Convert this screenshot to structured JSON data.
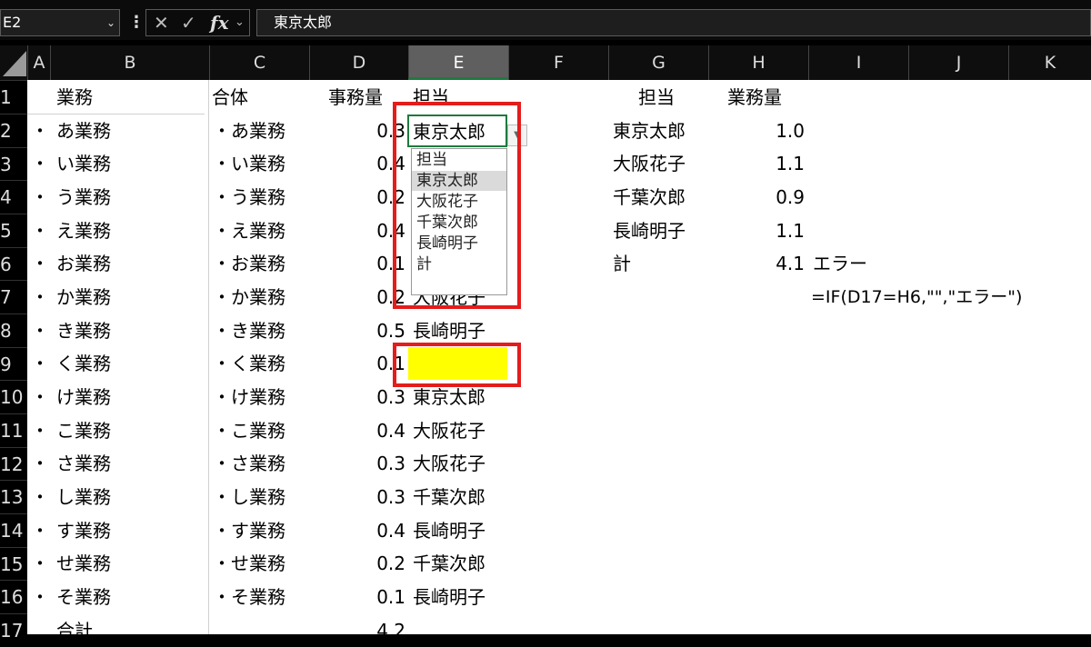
{
  "formula_bar": {
    "name_box": "E2",
    "name_box_dropdown": "⌄",
    "options_icon": "⋮",
    "cancel_icon": "✕",
    "enter_icon": "✓",
    "fx_label": "fx",
    "fx_dropdown": "⌄",
    "formula": "東京太郎"
  },
  "columns": [
    "A",
    "B",
    "C",
    "D",
    "E",
    "F",
    "G",
    "H",
    "I",
    "J",
    "K"
  ],
  "selected_column": "E",
  "rows": [
    "1",
    "2",
    "3",
    "4",
    "5",
    "6",
    "7",
    "8",
    "9",
    "10",
    "11",
    "12",
    "13",
    "14",
    "15",
    "16",
    "17"
  ],
  "headers": {
    "B": "業務",
    "C": "合体",
    "D": "事務量",
    "E": "担当",
    "G": "担当",
    "H": "業務量"
  },
  "bullet": "・",
  "table": [
    {
      "b": "あ業務",
      "c": "・あ業務",
      "d": "0.3",
      "e": ""
    },
    {
      "b": "い業務",
      "c": "・い業務",
      "d": "0.4",
      "e": ""
    },
    {
      "b": "う業務",
      "c": "・う業務",
      "d": "0.2",
      "e": ""
    },
    {
      "b": "え業務",
      "c": "・え業務",
      "d": "0.4",
      "e": ""
    },
    {
      "b": "お業務",
      "c": "・お業務",
      "d": "0.1",
      "e": ""
    },
    {
      "b": "か業務",
      "c": "・か業務",
      "d": "0.2",
      "e": "大阪花子"
    },
    {
      "b": "き業務",
      "c": "・き業務",
      "d": "0.5",
      "e": "長崎明子"
    },
    {
      "b": "く業務",
      "c": "・く業務",
      "d": "0.1",
      "e": ""
    },
    {
      "b": "け業務",
      "c": "・け業務",
      "d": "0.3",
      "e": "東京太郎"
    },
    {
      "b": "こ業務",
      "c": "・こ業務",
      "d": "0.4",
      "e": "大阪花子"
    },
    {
      "b": "さ業務",
      "c": "・さ業務",
      "d": "0.3",
      "e": "大阪花子"
    },
    {
      "b": "し業務",
      "c": "・し業務",
      "d": "0.3",
      "e": "千葉次郎"
    },
    {
      "b": "す業務",
      "c": "・す業務",
      "d": "0.4",
      "e": "長崎明子"
    },
    {
      "b": "せ業務",
      "c": "・せ業務",
      "d": "0.2",
      "e": "千葉次郎"
    },
    {
      "b": "そ業務",
      "c": "・そ業務",
      "d": "0.1",
      "e": "長崎明子"
    }
  ],
  "total": {
    "label": "合計",
    "value": "4.2"
  },
  "active_cell_value": "東京太郎",
  "dropdown_options": [
    "担当",
    "東京太郎",
    "大阪花子",
    "千葉次郎",
    "長崎明子",
    "計"
  ],
  "dropdown_highlighted": 1,
  "summary": [
    {
      "name": "東京太郎",
      "value": "1.0"
    },
    {
      "name": "大阪花子",
      "value": "1.1"
    },
    {
      "name": "千葉次郎",
      "value": "0.9"
    },
    {
      "name": "長崎明子",
      "value": "1.1"
    },
    {
      "name": "計",
      "value": "4.1"
    }
  ],
  "error_text": "エラー",
  "formula_note": "=IF(D17=H6,\"\",\"エラー\")",
  "colors": {
    "highlight_yellow": "#ffff00",
    "annotation_red": "#e41c1c",
    "selection_green": "#1d7a3e"
  }
}
